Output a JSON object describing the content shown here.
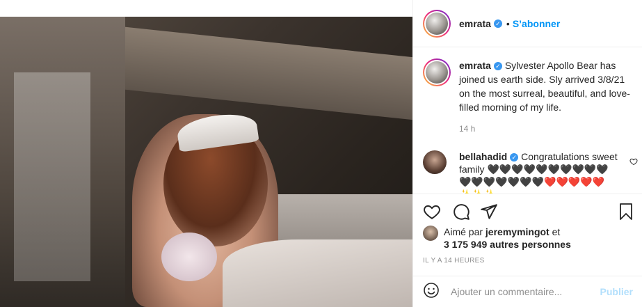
{
  "post": {
    "username": "emrata",
    "follow_label": "S’abonner",
    "separator": "•",
    "caption": "Sylvester Apollo Bear has joined us earth side. Sly arrived 3/8/21 on the most surreal, beautiful, and love-filled morning of my life.",
    "relative_time": "14 h"
  },
  "comment": {
    "username": "bellahadid",
    "text": "Congratulations sweet family 🖤🖤🖤🖤🖤🖤🖤🖤🖤🖤🖤🖤🖤🖤🖤🖤🖤❤️❤️❤️❤️❤️✨✨✨"
  },
  "likes": {
    "prefix": "Aimé par",
    "user": "jeremymingot",
    "and": "et",
    "count": "3 175 949 autres personnes"
  },
  "time_ago": "IL Y A 14 HEURES",
  "add_comment": {
    "placeholder": "Ajouter un commentaire...",
    "publish_label": "Publier"
  },
  "icons": {
    "verified": "verified-badge-icon",
    "like": "heart-icon",
    "comment": "comment-icon",
    "share": "paper-plane-icon",
    "save": "bookmark-icon",
    "emoji": "emoji-icon",
    "comment_like": "heart-small-icon"
  },
  "colors": {
    "accent": "#0095f6",
    "verified": "#3897f0",
    "muted": "#8e8e8e",
    "publish_disabled": "#b2dffc"
  }
}
